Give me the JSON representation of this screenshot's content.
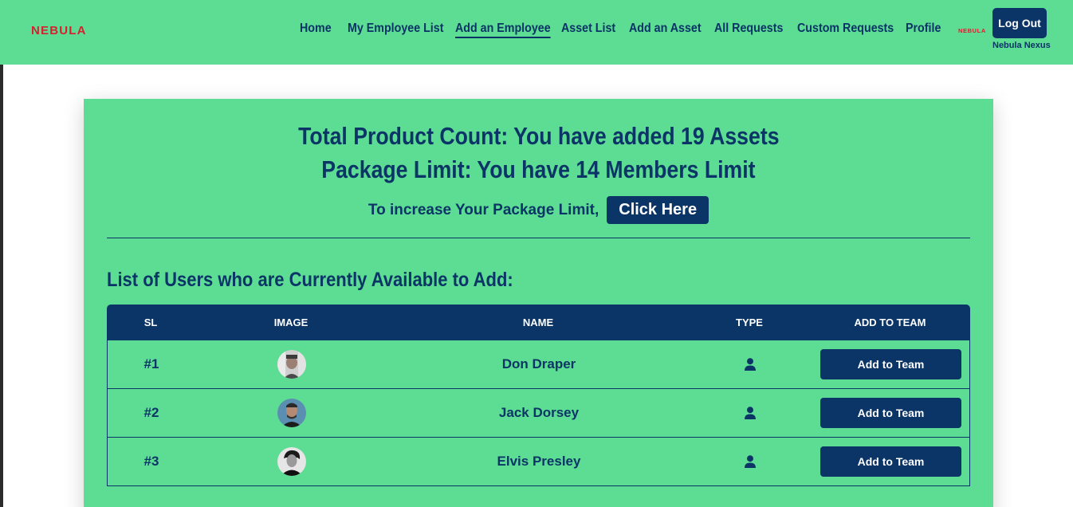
{
  "navbar": {
    "brand": "NEBULA",
    "links": [
      {
        "label": "Home"
      },
      {
        "label": "My Employee List"
      },
      {
        "label": "Add an Employee",
        "active": true
      },
      {
        "label": "Asset List"
      },
      {
        "label": "Add an Asset"
      },
      {
        "label": "All Requests"
      },
      {
        "label": "Custom Requests"
      },
      {
        "label": "Profile"
      }
    ],
    "mini_logo": "NEBULA",
    "logout_label": "Log Out",
    "company_name": "Nebula Nexus"
  },
  "summary": {
    "product_count_line": "Total Product Count: You have added 19 Assets",
    "package_limit_line": "Package Limit: You have 14 Members Limit",
    "increase_text": "To increase Your Package Limit,",
    "click_here_label": "Click Here"
  },
  "users_section": {
    "title": "List of Users who are Currently Available to Add:",
    "columns": [
      "SL",
      "IMAGE",
      "NAME",
      "TYPE",
      "ADD TO TEAM"
    ],
    "rows": [
      {
        "sl": "#1",
        "name": "Don Draper",
        "type_icon": "user-icon",
        "button": "Add to Team"
      },
      {
        "sl": "#2",
        "name": "Jack Dorsey",
        "type_icon": "user-icon",
        "button": "Add to Team"
      },
      {
        "sl": "#3",
        "name": "Elvis Presley",
        "type_icon": "user-icon",
        "button": "Add to Team"
      }
    ]
  },
  "colors": {
    "primary_green": "#5ddd93",
    "navy": "#0b3566",
    "brand_red": "#d6202f"
  }
}
